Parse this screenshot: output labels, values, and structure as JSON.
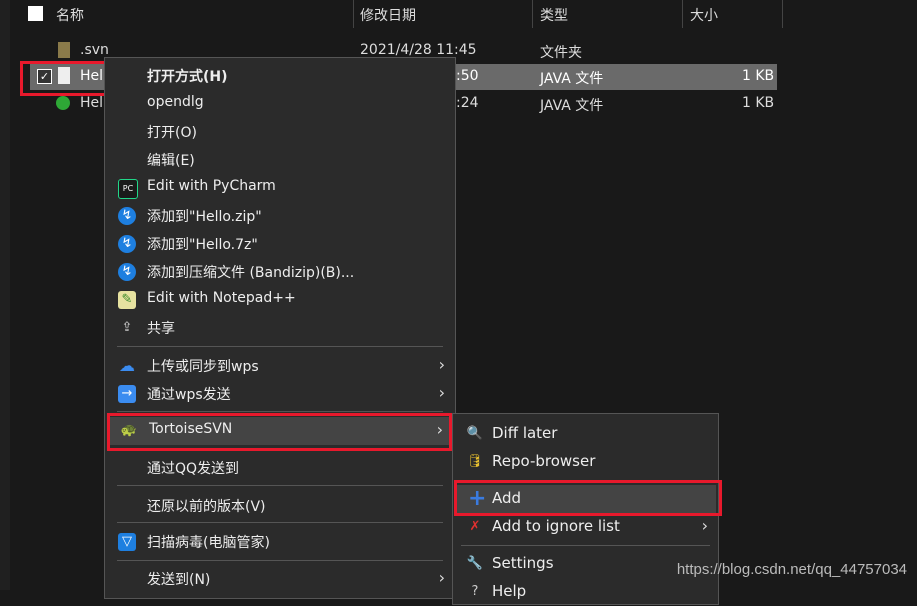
{
  "columns": {
    "name": "名称",
    "date": "修改日期",
    "type": "类型",
    "size": "大小"
  },
  "files": [
    {
      "name": ".svn",
      "date": "2021/4/28 11:45",
      "type": "文件夹",
      "size": "",
      "icon": "folder-icon"
    },
    {
      "name": "Hel",
      "date": ":50",
      "type": "JAVA 文件",
      "size": "1 KB",
      "icon": "file-icon",
      "selected": true
    },
    {
      "name": "Hel",
      "date": ":24",
      "type": "JAVA 文件",
      "size": "1 KB",
      "icon": "svn-ok-file-icon"
    }
  ],
  "menu": {
    "items": [
      {
        "label": "打开方式(H)"
      },
      {
        "label": "opendlg"
      },
      {
        "label": "打开(O)"
      },
      {
        "label": "编辑(E)"
      },
      {
        "label": "Edit with PyCharm",
        "icon": "pycharm-icon"
      },
      {
        "label": "添加到\"Hello.zip\"",
        "icon": "bandizip-icon"
      },
      {
        "label": "添加到\"Hello.7z\"",
        "icon": "bandizip-icon"
      },
      {
        "label": "添加到压缩文件 (Bandizip)(B)...",
        "icon": "bandizip-icon"
      },
      {
        "label": "Edit with Notepad++",
        "icon": "notepadpp-icon"
      },
      {
        "label": "共享",
        "icon": "share-icon"
      },
      {
        "label": "上传或同步到wps",
        "icon": "cloud-upload-icon"
      },
      {
        "label": "通过wps发送",
        "icon": "wps-send-icon"
      },
      {
        "label": "TortoiseSVN",
        "icon": "tortoisesvn-icon"
      },
      {
        "label": "通过QQ发送到"
      },
      {
        "label": "还原以前的版本(V)"
      },
      {
        "label": "扫描病毒(电脑管家)",
        "icon": "pc-manager-shield-icon"
      },
      {
        "label": "发送到(N)"
      }
    ]
  },
  "submenu": {
    "items": [
      {
        "label": "Diff later",
        "icon": "magnifier-icon"
      },
      {
        "label": "Repo-browser",
        "icon": "repo-browser-icon"
      },
      {
        "label": "Add",
        "icon": "plus-icon"
      },
      {
        "label": "Add to ignore list",
        "icon": "ignore-icon"
      },
      {
        "label": "Settings",
        "icon": "wrench-icon"
      },
      {
        "label": "Help",
        "icon": "help-icon"
      }
    ]
  },
  "watermark": "https://blog.csdn.net/qq_44757034",
  "colors": {
    "highlight": "#e8192c",
    "menu_bg": "#2b2b2b",
    "background": "#191919"
  }
}
